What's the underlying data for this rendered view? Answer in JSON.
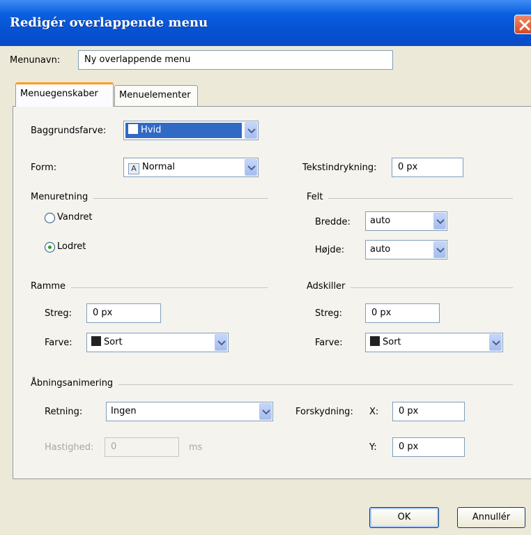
{
  "window": {
    "title": "Redigér overlappende menu"
  },
  "menu_name": {
    "label": "Menunavn:",
    "value": "Ny overlappende menu"
  },
  "tabs": [
    {
      "label": "Menuegenskaber",
      "active": true
    },
    {
      "label": "Menuelementer",
      "active": false
    }
  ],
  "properties": {
    "background": {
      "label": "Baggrundsfarve:",
      "value": "Hvid",
      "swatch_color": "#ffffff",
      "selected_highlight": "#316ac5"
    },
    "shape": {
      "label": "Form:",
      "value": "Normal",
      "icon": "A"
    },
    "text_indent": {
      "label": "Tekstindrykning:",
      "value": "0 px"
    },
    "direction": {
      "group_label": "Menuretning",
      "options": [
        {
          "label": "Vandret",
          "checked": false
        },
        {
          "label": "Lodret",
          "checked": true
        }
      ]
    },
    "field": {
      "group_label": "Felt",
      "width_label": "Bredde:",
      "width_value": "auto",
      "height_label": "Højde:",
      "height_value": "auto"
    },
    "border": {
      "group_label": "Ramme",
      "stroke_label": "Streg:",
      "stroke_value": "0 px",
      "color_label": "Farve:",
      "color_value": "Sort",
      "swatch_color": "#222222"
    },
    "separator": {
      "group_label": "Adskiller",
      "stroke_label": "Streg:",
      "stroke_value": "0 px",
      "color_label": "Farve:",
      "color_value": "Sort",
      "swatch_color": "#222222"
    },
    "animation": {
      "group_label": "Åbningsanimering",
      "direction_label": "Retning:",
      "direction_value": "Ingen",
      "offset_label": "Forskydning:",
      "x_label": "X:",
      "x_value": "0 px",
      "y_label": "Y:",
      "y_value": "0 px",
      "speed_label": "Hastighed:",
      "speed_value": "0",
      "speed_unit": "ms"
    }
  },
  "buttons": {
    "ok": "OK",
    "cancel": "Annullér"
  }
}
